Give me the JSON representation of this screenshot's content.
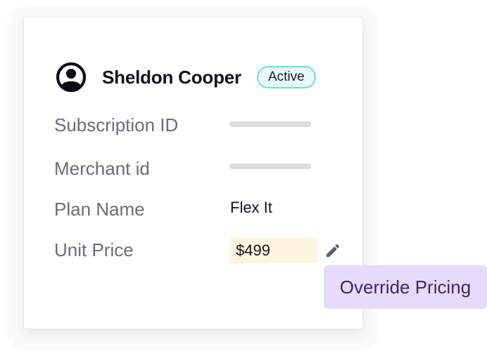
{
  "user": {
    "name": "Sheldon Cooper",
    "status": "Active",
    "status_color": "#6fe0c6",
    "avatar_icon": "account-circle-icon"
  },
  "fields": {
    "subscription_id": {
      "label": "Subscription ID"
    },
    "merchant_id": {
      "label": "Merchant id"
    },
    "plan_name": {
      "label": "Plan Name",
      "value": "Flex It"
    },
    "unit_price": {
      "label": "Unit Price",
      "value": "$499"
    }
  },
  "actions": {
    "edit_icon": "pencil-icon",
    "override_tooltip": "Override Pricing"
  },
  "colors": {
    "price_highlight": "#fff5df",
    "tooltip_bg": "#e7dbfb",
    "tooltip_text": "#3e2664"
  }
}
